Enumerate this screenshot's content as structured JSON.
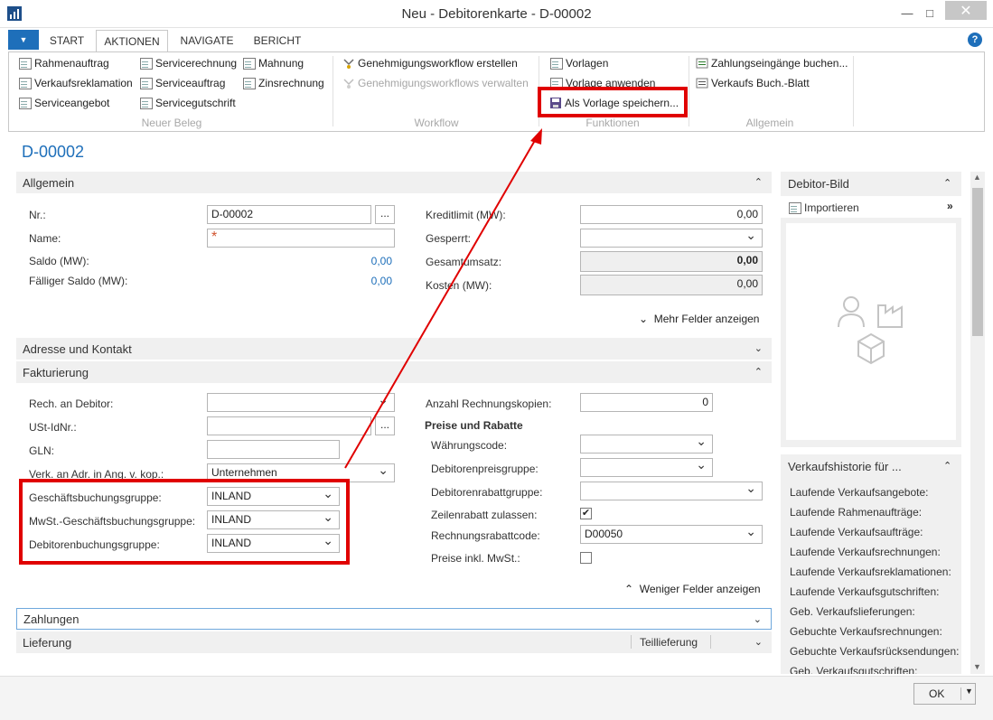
{
  "window": {
    "title": "Neu - Debitorenkarte - D-00002"
  },
  "ribbon": {
    "tabs": [
      "START",
      "AKTIONEN",
      "NAVIGATE",
      "BERICHT"
    ],
    "groups": {
      "neuer_beleg": {
        "label": "Neuer Beleg",
        "items": [
          "Rahmenauftrag",
          "Verkaufsreklamation",
          "Serviceangebot",
          "Servicerechnung",
          "Serviceauftrag",
          "Servicegutschrift",
          "Mahnung",
          "Zinsrechnung"
        ]
      },
      "workflow": {
        "label": "Workflow",
        "items": [
          "Genehmigungsworkflow erstellen",
          "Genehmigungsworkflows verwalten"
        ]
      },
      "funktionen": {
        "label": "Funktionen",
        "items": [
          "Vorlagen",
          "Vorlage anwenden",
          "Als Vorlage speichern..."
        ]
      },
      "allgemein": {
        "label": "Allgemein",
        "items": [
          "Zahlungseingänge buchen...",
          "Verkaufs Buch.-Blatt"
        ]
      }
    }
  },
  "page": {
    "title": "D-00002"
  },
  "allgemein": {
    "header": "Allgemein",
    "nr_label": "Nr.:",
    "nr_value": "D-00002",
    "name_label": "Name:",
    "name_required": "*",
    "saldo_label": "Saldo (MW):",
    "saldo_value": "0,00",
    "faelliger_label": "Fälliger Saldo (MW):",
    "faelliger_value": "0,00",
    "kreditlimit_label": "Kreditlimit (MW):",
    "kreditlimit_value": "0,00",
    "gesperrt_label": "Gesperrt:",
    "gesperrt_value": "",
    "gesamtumsatz_label": "Gesamtumsatz:",
    "gesamtumsatz_value": "0,00",
    "kosten_label": "Kosten (MW):",
    "kosten_value": "0,00",
    "more_fields": "Mehr Felder anzeigen"
  },
  "adresse": {
    "header": "Adresse und Kontakt"
  },
  "fakturierung": {
    "header": "Fakturierung",
    "rech_label": "Rech. an Debitor:",
    "ust_label": "USt-IdNr.:",
    "gln_label": "GLN:",
    "verk_label": "Verk. an Adr. in Ang. v. kop.:",
    "verk_value": "Unternehmen",
    "gesch_label": "Geschäftsbuchungsgruppe:",
    "gesch_value": "INLAND",
    "mwst_label": "MwSt.-Geschäftsbuchungsgruppe:",
    "mwst_value": "INLAND",
    "debbuch_label": "Debitorenbuchungsgruppe:",
    "debbuch_value": "INLAND",
    "kopien_label": "Anzahl Rechnungskopien:",
    "kopien_value": "0",
    "preise_heading": "Preise und Rabatte",
    "waehrung_label": "Währungscode:",
    "preisgruppe_label": "Debitorenpreisgruppe:",
    "rabattgruppe_label": "Debitorenrabattgruppe:",
    "zeilenrabatt_label": "Zeilenrabatt zulassen:",
    "zeilenrabatt_checked": true,
    "rechrabatt_label": "Rechnungsrabattcode:",
    "rechrabatt_value": "D00050",
    "preise_inkl_label": "Preise inkl. MwSt.:",
    "preise_inkl_checked": false,
    "fewer_fields": "Weniger Felder anzeigen"
  },
  "zahlungen": {
    "header": "Zahlungen"
  },
  "lieferung": {
    "header": "Lieferung",
    "extra": "Teillieferung"
  },
  "factbox_bild": {
    "header": "Debitor-Bild",
    "import": "Importieren"
  },
  "factbox_historie": {
    "header": "Verkaufshistorie für ...",
    "items": [
      "Laufende Verkaufsangebote:",
      "Laufende Rahmenaufträge:",
      "Laufende Verkaufsaufträge:",
      "Laufende Verkaufsrechnungen:",
      "Laufende Verkaufsreklamationen:",
      "Laufende Verkaufsgutschriften:",
      "Geb. Verkaufslieferungen:",
      "Gebuchte Verkaufsrechnungen:",
      "Gebuchte Verkaufsrücksendungen:",
      "Geb. Verkaufsgutschriften:"
    ]
  },
  "footer": {
    "ok": "OK"
  },
  "colors": {
    "accent": "#1e6fba",
    "highlight": "#e00000"
  }
}
